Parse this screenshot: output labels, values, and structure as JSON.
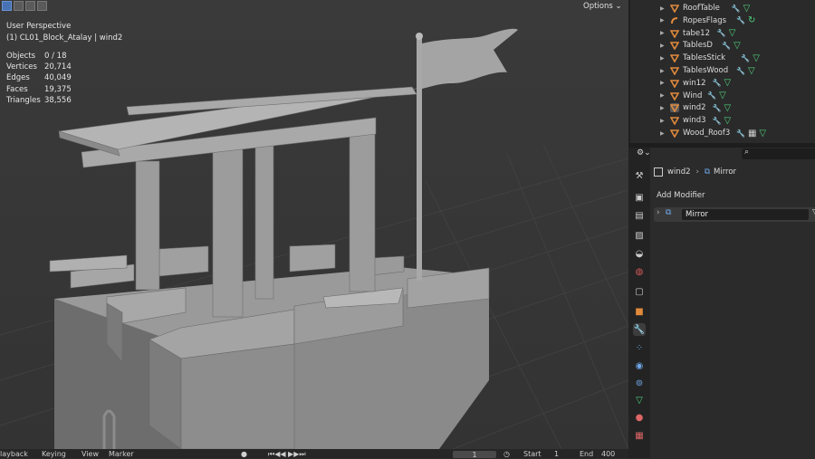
{
  "viewport": {
    "title": "User Perspective",
    "subtitle": "(1) CL01_Block_Atalay | wind2",
    "options_label": "Options",
    "stats": [
      {
        "label": "Objects",
        "value": "0 / 18"
      },
      {
        "label": "Vertices",
        "value": "20,714"
      },
      {
        "label": "Edges",
        "value": "40,049"
      },
      {
        "label": "Faces",
        "value": "19,375"
      },
      {
        "label": "Triangles",
        "value": "38,556"
      }
    ]
  },
  "outliner": {
    "items": [
      {
        "label": "RoofTable",
        "icon": "mesh-icon",
        "mods": [
          "wrench-icon",
          "mesh-data-icon"
        ]
      },
      {
        "label": "RopesFlags",
        "icon": "curve-icon",
        "mods": [
          "wrench-icon",
          "curve-data-icon"
        ]
      },
      {
        "label": "tabe12",
        "icon": "mesh-icon",
        "mods": [
          "wrench-icon",
          "mesh-data-icon"
        ]
      },
      {
        "label": "TablesD",
        "icon": "mesh-icon",
        "mods": [
          "wrench-icon",
          "mesh-data-icon"
        ]
      },
      {
        "label": "TablesStick",
        "icon": "mesh-icon",
        "mods": [
          "wrench-icon",
          "mesh-data-icon"
        ]
      },
      {
        "label": "TablesWood",
        "icon": "mesh-icon",
        "mods": [
          "wrench-icon",
          "mesh-data-icon"
        ]
      },
      {
        "label": "win12",
        "icon": "mesh-icon",
        "mods": [
          "wrench-icon",
          "mesh-data-icon"
        ]
      },
      {
        "label": "Wind",
        "icon": "mesh-icon",
        "mods": [
          "wrench-icon",
          "mesh-data-icon"
        ]
      },
      {
        "label": "wind2",
        "icon": "mesh-icon",
        "mods": [
          "wrench-icon",
          "mesh-data-icon"
        ],
        "selected": true
      },
      {
        "label": "wind3",
        "icon": "mesh-icon",
        "mods": [
          "wrench-icon",
          "mesh-data-icon"
        ]
      },
      {
        "label": "Wood_Roof3",
        "icon": "mesh-icon",
        "mods": [
          "wrench-icon",
          "checker-icon",
          "mesh-data-icon"
        ]
      }
    ]
  },
  "properties": {
    "breadcrumb_object": "wind2",
    "breadcrumb_modifier": "Mirror",
    "add_modifier_label": "Add Modifier",
    "modifier_name": "Mirror",
    "tabs": [
      "tool-icon",
      "render-icon",
      "output-icon",
      "view-layer-icon",
      "scene-icon",
      "world-icon",
      "collection-icon",
      "object-icon",
      "modifier-icon",
      "particles-icon",
      "physics-icon",
      "constraints-icon",
      "data-icon",
      "material-icon",
      "texture-icon"
    ]
  },
  "timeline": {
    "labels": [
      "layback",
      "Keying",
      "View",
      "Marker"
    ],
    "current_frame": "1",
    "start_label": "Start",
    "start_value": "1",
    "end_label": "End",
    "end_value": "400"
  },
  "colors": {
    "mesh_orange": "#e08a3c",
    "data_green": "#4fd27c",
    "modifier_blue": "#6fa8e8",
    "accent_blue": "#4772b3"
  }
}
